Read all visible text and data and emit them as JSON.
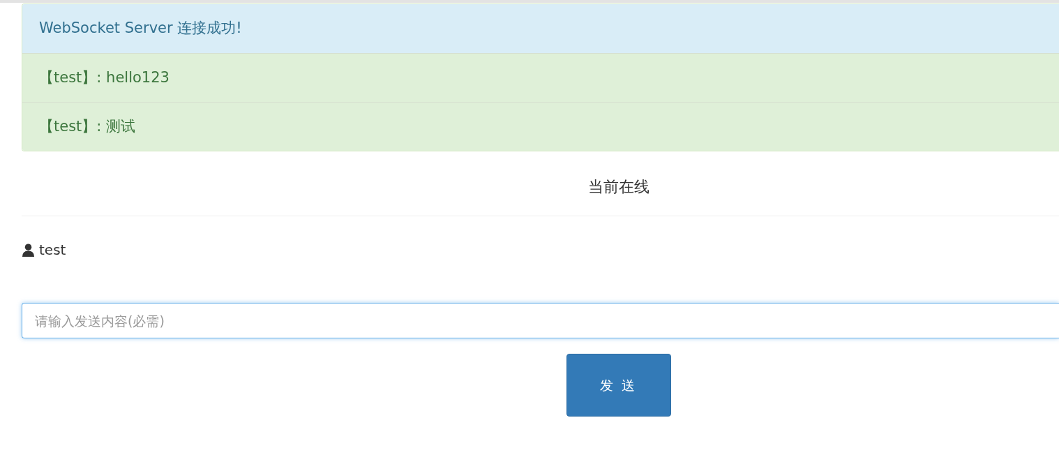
{
  "messages": [
    {
      "kind": "info",
      "text": "WebSocket Server 连接成功!"
    },
    {
      "kind": "success",
      "text": "【test】: hello123"
    },
    {
      "kind": "success",
      "text": "【test】: 测试"
    }
  ],
  "online": {
    "title": "当前在线",
    "users": [
      "test"
    ]
  },
  "compose": {
    "placeholder": "请输入发送内容(必需)",
    "focused": true
  },
  "send_button": "发 送"
}
